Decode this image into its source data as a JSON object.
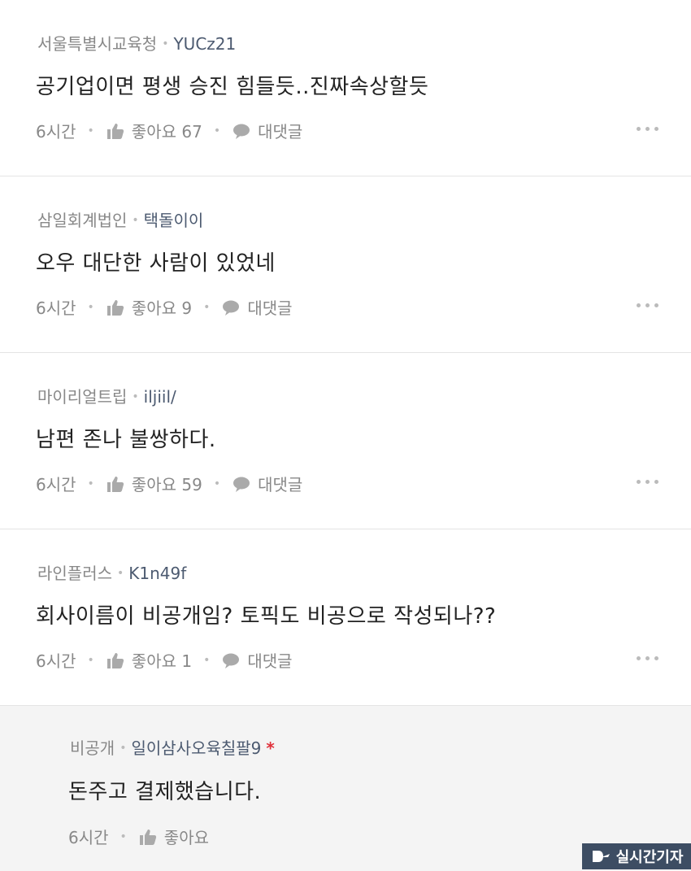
{
  "comments": [
    {
      "company": "서울특별시교육청",
      "nickname": "YUCz21",
      "text": "공기업이면 평생 승진 힘들듯..진짜속상할듯",
      "time": "6시간",
      "likes": "좋아요 67",
      "reply": "대댓글"
    },
    {
      "company": "삼일회계법인",
      "nickname": "택돌이이",
      "text": "오우 대단한 사람이 있었네",
      "time": "6시간",
      "likes": "좋아요 9",
      "reply": "대댓글"
    },
    {
      "company": "마이리얼트립",
      "nickname": "iljiil/",
      "text": "남편 존나 불쌍하다.",
      "time": "6시간",
      "likes": "좋아요 59",
      "reply": "대댓글"
    },
    {
      "company": "라인플러스",
      "nickname": "K1n49f",
      "text": "회사이름이 비공개임? 토픽도 비공으로 작성되나??",
      "time": "6시간",
      "likes": "좋아요 1",
      "reply": "대댓글"
    }
  ],
  "reply_comment": {
    "company": "비공개",
    "nickname": "일이삼사오육칠팔9",
    "op_mark": "*",
    "text": "돈주고 결제했습니다.",
    "time": "6시간",
    "likes": "좋아요"
  },
  "watermark": {
    "text": "실시간기자"
  },
  "colors": {
    "nickname": "#4c5a70",
    "op_mark": "#e0303a",
    "reply_bg": "#f4f4f4"
  },
  "icons": [
    "thumbs-up-icon",
    "speech-bubble-icon",
    "more-dots-icon"
  ]
}
